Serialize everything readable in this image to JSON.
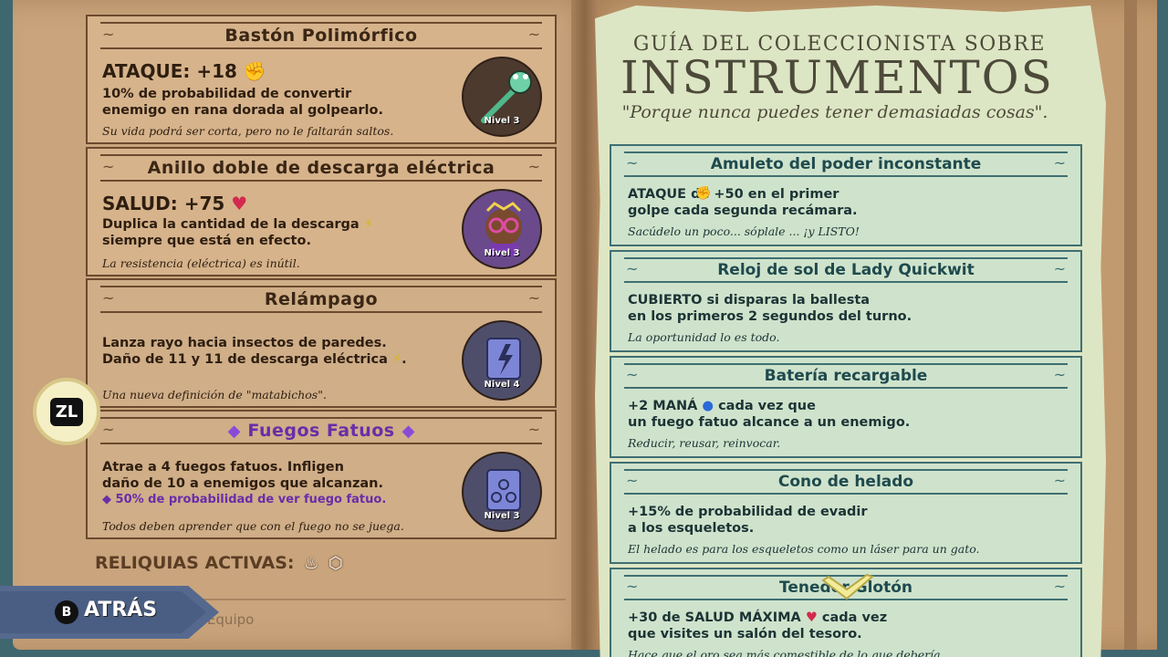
{
  "left_cards": [
    {
      "title": "Bastón Polimórfico",
      "stat": "ATAQUE: +18",
      "stat_icon": "fist-icon",
      "desc_line1": "10% de probabilidad de convertir",
      "desc_line2": "enemigo en rana dorada al golpearlo.",
      "flavor": "Su vida podrá ser corta, pero no le faltarán saltos.",
      "level": "Nivel 3"
    },
    {
      "title": "Anillo doble de descarga eléctrica",
      "stat": "SALUD: +75",
      "stat_icon": "heart-icon",
      "desc_line1": "Duplica la cantidad de la descarga",
      "desc_line2": "siempre que está en efecto.",
      "flavor": "La resistencia (eléctrica) es inútil.",
      "level": "Nivel 3"
    },
    {
      "title": "Relámpago",
      "desc_line1": "Lanza rayo hacia insectos de paredes.",
      "desc_line2": "Daño de 11 y 11 de descarga eléctrica",
      "flavor": "Una nueva definición de \"matabichos\".",
      "level": "Nivel 4"
    },
    {
      "title": "Fuegos Fatuos",
      "desc_line1": "Atrae a 4 fuegos fatuos. Infligen",
      "desc_line2": "daño de 10 a enemigos que alcanzan.",
      "desc_line3": "50% de probabilidad de ver fuego fatuo.",
      "flavor": "Todos deben aprender que con el fuego no se juega.",
      "level": "Nivel 3"
    }
  ],
  "relics_label": "RELIQUIAS ACTIVAS:",
  "zl_label": "ZL",
  "back_button": {
    "key": "B",
    "label": "ATRÁS"
  },
  "team_label": "i Equipo",
  "guide": {
    "title_small": "GUÍA DEL COLECCIONISTA SOBRE",
    "title_big": "INSTRUMENTOS",
    "quote": "\"Porque nunca puedes tener demasiadas cosas\"."
  },
  "right_cards": [
    {
      "title": "Amuleto del poder inconstante",
      "desc_line1": " ATAQUE  de +50 en el primer",
      "desc_line2": "golpe cada segunda recámara.",
      "flavor": "Sacúdelo un poco... sóplale ... ¡y LISTO!"
    },
    {
      "title": "Reloj de sol de Lady Quickwit",
      "desc_line1": "CUBIERTO  si disparas la ballesta",
      "desc_line2": "en los primeros 2 segundos del turno.",
      "flavor": "La oportunidad lo es todo."
    },
    {
      "title": "Batería recargable",
      "desc_line1": " +2 MANÁ",
      "desc_line1b": " cada vez que",
      "desc_line2": "un fuego fatuo alcance a un enemigo.",
      "flavor": "Reducir, reusar, reinvocar."
    },
    {
      "title": "Cono de helado",
      "desc_line1": " +15% de probabilidad de evadir",
      "desc_line2": "a los esqueletos.",
      "flavor": "El helado es para los esqueletos como un láser para un gato."
    },
    {
      "title": "Tenedor  Glotón",
      "desc_line1": " +30 de SALUD MÁXIMA",
      "desc_line1b": " cada vez",
      "desc_line2": "que visites un salón del tesoro.",
      "flavor": "Hace que el oro sea más comestible de lo que debería."
    }
  ],
  "colors": {
    "left_page": "#c9a47c",
    "parchment": "#dde6c4",
    "teal_border": "#3f6f72",
    "purple": "#6a2da8",
    "back_bar": "#55698f"
  }
}
